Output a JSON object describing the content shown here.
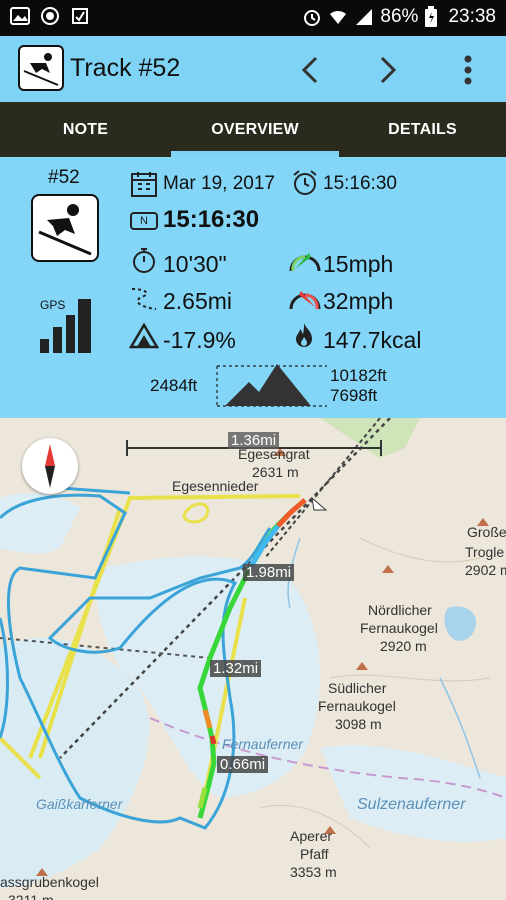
{
  "status_bar": {
    "battery": "86%",
    "time": "23:38",
    "icons": [
      "image-icon",
      "record-icon",
      "sync-icon",
      "alarm-icon",
      "wifi-icon",
      "signal-icon",
      "battery-icon"
    ]
  },
  "app_bar": {
    "title": "Track #52",
    "icon": "skier-icon",
    "prev_icon": "chevron-left-icon",
    "next_icon": "chevron-right-icon",
    "menu_icon": "more-vert-icon"
  },
  "tabs": [
    {
      "label": "NOTE",
      "selected": false
    },
    {
      "label": "OVERVIEW",
      "selected": true
    },
    {
      "label": "DETAILS",
      "selected": false
    }
  ],
  "overview": {
    "track_number": "#52",
    "gps_label": "GPS",
    "gps_signal_level": 4,
    "date": "Mar 19, 2017",
    "start_time": "15:16:30",
    "duration_badge": "N",
    "duration_total": "15:16:30",
    "moving_time": "10'30\"",
    "avg_speed": "15mph",
    "distance": "2.65mi",
    "max_speed": "32mph",
    "slope": "-17.9%",
    "calories": "147.7kcal",
    "elevation_gain": "2484ft",
    "elevation_max": "10182ft",
    "elevation_min": "7698ft"
  },
  "map": {
    "scale_label": "1.36mi",
    "distance_markers": [
      "1.98mi",
      "1.32mi",
      "0.66mi"
    ],
    "places": [
      {
        "name": "Egesengrat",
        "elev": "2631 m"
      },
      {
        "name": "Egesennieder",
        "elev": ""
      },
      {
        "name": "Große",
        "elev": "Trogle"
      },
      {
        "name": "",
        "elev": "2902 m"
      },
      {
        "name": "Nördlicher",
        "elev": "Fernaukogel"
      },
      {
        "name": "",
        "elev": "2920 m"
      },
      {
        "name": "Südlicher",
        "elev": "Fernaukogel"
      },
      {
        "name": "",
        "elev": "3098 m"
      },
      {
        "name": "Fernauferner",
        "elev": ""
      },
      {
        "name": "Sulzenauferner",
        "elev": ""
      },
      {
        "name": "Gaißkarferner",
        "elev": ""
      },
      {
        "name": "Aperer",
        "elev": "Pfaff"
      },
      {
        "name": "",
        "elev": "3353 m"
      },
      {
        "name": "assgrubenkogel",
        "elev": "3211 m"
      }
    ]
  }
}
